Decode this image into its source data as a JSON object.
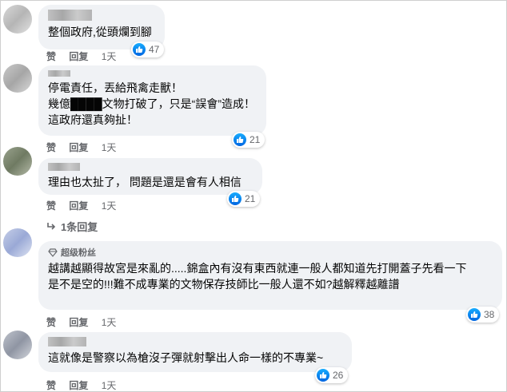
{
  "comments": [
    {
      "text": "整個政府,從頭爛到腳",
      "likes": "47",
      "actions": {
        "like": "赞",
        "reply": "回复",
        "time": "1天"
      }
    },
    {
      "text": "停電責任，丟給飛禽走獸！\n幾億████文物打破了，只是“誤會”造成！\n這政府還真夠扯！",
      "likes": "21",
      "actions": {
        "like": "赞",
        "reply": "回复",
        "time": "1天"
      }
    },
    {
      "text": "理由也太扯了， 問題是還是會有人相信",
      "likes": "21",
      "actions": {
        "like": "赞",
        "reply": "回复",
        "time": "1天"
      },
      "replies_label": "1条回复"
    },
    {
      "badge": "超级粉丝",
      "text": "越講越顯得故宮是來亂的.....錦盒內有沒有東西就連一般人都知道先打開蓋子先看一下\n是不是空的!!!難不成專業的文物保存技師比一般人還不如?越解釋越離譜",
      "likes": "38",
      "actions": {
        "like": "赞",
        "reply": "回复",
        "time": "1天"
      }
    },
    {
      "text": "這就像是警察以為槍沒子彈就射擊出人命一樣的不專業~",
      "likes": "26",
      "actions": {
        "like": "赞",
        "reply": "回复",
        "time": "1天"
      }
    }
  ],
  "colors": {
    "bubble": "#f0f2f5",
    "like_blue": "#0866ff",
    "meta_gray": "#65676b"
  },
  "icons": {
    "like": "thumbs-up-icon",
    "reply_arrow": "reply-arrow-icon",
    "badge": "diamond-icon"
  }
}
